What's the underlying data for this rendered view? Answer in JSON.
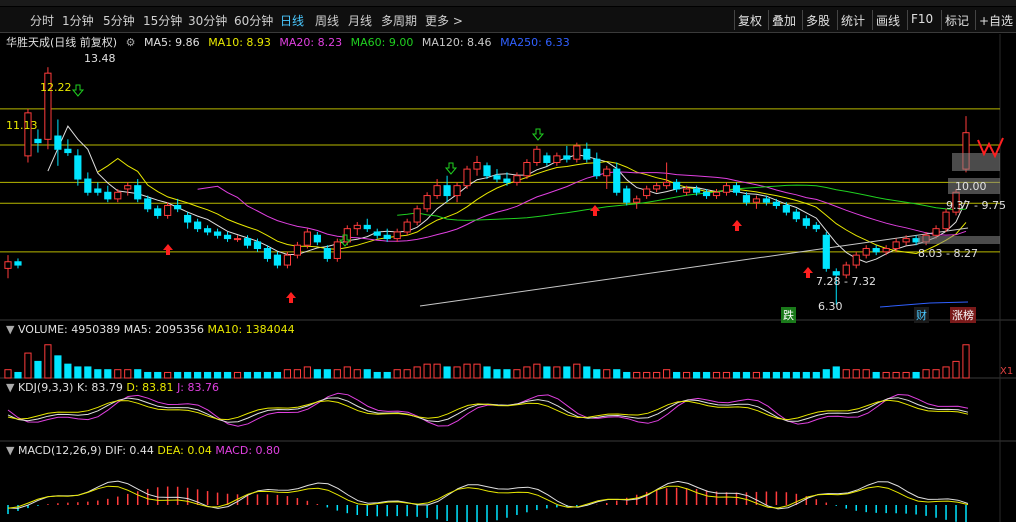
{
  "toolbar": {
    "timeframes": [
      "分时",
      "1分钟",
      "5分钟",
      "15分钟",
      "30分钟",
      "60分钟",
      "日线",
      "周线",
      "月线",
      "多周期",
      "更多 >"
    ],
    "active": "日线",
    "buttons": [
      "复权",
      "叠加",
      "多股",
      "统计",
      "画线",
      "F10",
      "标记",
      "+自选"
    ]
  },
  "main": {
    "stock_label": "华胜天成(日线 前复权)",
    "ma_labels": [
      {
        "text": "MA5: 9.86",
        "color": "#e0e0e0"
      },
      {
        "text": "MA10: 8.93",
        "color": "#e8e800"
      },
      {
        "text": "MA20: 8.23",
        "color": "#e040e0"
      },
      {
        "text": "MA60: 9.00",
        "color": "#20d020"
      },
      {
        "text": "MA120: 8.46",
        "color": "#c8c8c8"
      },
      {
        "text": "MA250: 6.33",
        "color": "#3060ff"
      }
    ],
    "price_labels": {
      "high": "13.48",
      "p1222": "12.22",
      "p1113": "11.13",
      "p1000": "10.00",
      "p937": "9.37 - 9.75",
      "p803": "8.03 - 8.27",
      "p728": "7.28 - 7.32",
      "low": "6.30"
    },
    "tags": {
      "die": "跌",
      "cai": "财",
      "zhangbang": "涨榜"
    }
  },
  "volume": {
    "label": "VOLUME: 4950389",
    "ma5": "MA5: 2095356",
    "ma10": "MA10: 1384044",
    "axis": "X1"
  },
  "kdj": {
    "label": "KDJ(9,3,3)",
    "k": "K: 83.79",
    "d": "D: 83.81",
    "j": "J: 83.76"
  },
  "macd": {
    "label": "MACD(12,26,9)",
    "dif": "DIF: 0.44",
    "dea": "DEA: 0.04",
    "macd": "MACD: 0.80"
  },
  "colors": {
    "up": "#ff3c3c",
    "down": "#00e5ff",
    "ma5": "#e0e0e0",
    "ma10": "#e8e800",
    "ma20": "#e040e0",
    "ma60": "#20d020",
    "ma120": "#c8c8c8",
    "ma250": "#3060ff"
  },
  "chart_data": {
    "type": "candlestick",
    "title": "华胜天成(日线 前复权)",
    "ylim": [
      5.9,
      14.0
    ],
    "candles": [
      {
        "o": 7.4,
        "h": 7.8,
        "l": 7.1,
        "c": 7.6
      },
      {
        "o": 7.6,
        "h": 7.7,
        "l": 7.4,
        "c": 7.5
      },
      {
        "o": 10.8,
        "h": 12.22,
        "l": 10.6,
        "c": 12.1
      },
      {
        "o": 11.3,
        "h": 11.6,
        "l": 10.9,
        "c": 11.2
      },
      {
        "o": 11.3,
        "h": 13.48,
        "l": 11.0,
        "c": 13.3
      },
      {
        "o": 11.4,
        "h": 11.9,
        "l": 10.5,
        "c": 11.0
      },
      {
        "o": 11.0,
        "h": 11.3,
        "l": 10.8,
        "c": 10.9
      },
      {
        "o": 10.8,
        "h": 11.0,
        "l": 9.9,
        "c": 10.1
      },
      {
        "o": 10.1,
        "h": 10.3,
        "l": 9.6,
        "c": 9.7
      },
      {
        "o": 9.8,
        "h": 10.0,
        "l": 9.6,
        "c": 9.7
      },
      {
        "o": 9.7,
        "h": 9.9,
        "l": 9.4,
        "c": 9.5
      },
      {
        "o": 9.5,
        "h": 9.8,
        "l": 9.4,
        "c": 9.7
      },
      {
        "o": 9.8,
        "h": 10.0,
        "l": 9.6,
        "c": 9.9
      },
      {
        "o": 9.9,
        "h": 10.1,
        "l": 9.4,
        "c": 9.5
      },
      {
        "o": 9.5,
        "h": 9.6,
        "l": 9.1,
        "c": 9.2
      },
      {
        "o": 9.2,
        "h": 9.3,
        "l": 8.9,
        "c": 9.0
      },
      {
        "o": 9.0,
        "h": 9.4,
        "l": 8.9,
        "c": 9.3
      },
      {
        "o": 9.3,
        "h": 9.5,
        "l": 9.1,
        "c": 9.2
      },
      {
        "o": 9.0,
        "h": 9.1,
        "l": 8.6,
        "c": 8.8
      },
      {
        "o": 8.8,
        "h": 8.9,
        "l": 8.5,
        "c": 8.6
      },
      {
        "o": 8.6,
        "h": 8.7,
        "l": 8.4,
        "c": 8.5
      },
      {
        "o": 8.5,
        "h": 8.6,
        "l": 8.3,
        "c": 8.4
      },
      {
        "o": 8.4,
        "h": 8.5,
        "l": 8.2,
        "c": 8.3
      },
      {
        "o": 8.3,
        "h": 8.4,
        "l": 8.2,
        "c": 8.3
      },
      {
        "o": 8.3,
        "h": 8.4,
        "l": 8.0,
        "c": 8.1
      },
      {
        "o": 8.2,
        "h": 8.3,
        "l": 7.9,
        "c": 8.0
      },
      {
        "o": 8.0,
        "h": 8.1,
        "l": 7.6,
        "c": 7.7
      },
      {
        "o": 7.8,
        "h": 7.9,
        "l": 7.4,
        "c": 7.5
      },
      {
        "o": 7.5,
        "h": 7.9,
        "l": 7.4,
        "c": 7.8
      },
      {
        "o": 7.8,
        "h": 8.2,
        "l": 7.7,
        "c": 8.1
      },
      {
        "o": 8.1,
        "h": 8.6,
        "l": 8.0,
        "c": 8.5
      },
      {
        "o": 8.4,
        "h": 8.5,
        "l": 8.1,
        "c": 8.2
      },
      {
        "o": 8.0,
        "h": 8.1,
        "l": 7.6,
        "c": 7.7
      },
      {
        "o": 7.7,
        "h": 8.3,
        "l": 7.6,
        "c": 8.2
      },
      {
        "o": 8.2,
        "h": 8.7,
        "l": 8.1,
        "c": 8.6
      },
      {
        "o": 8.6,
        "h": 8.8,
        "l": 8.4,
        "c": 8.7
      },
      {
        "o": 8.7,
        "h": 8.9,
        "l": 8.5,
        "c": 8.6
      },
      {
        "o": 8.5,
        "h": 8.6,
        "l": 8.3,
        "c": 8.4
      },
      {
        "o": 8.4,
        "h": 8.6,
        "l": 8.2,
        "c": 8.3
      },
      {
        "o": 8.3,
        "h": 8.6,
        "l": 8.2,
        "c": 8.5
      },
      {
        "o": 8.5,
        "h": 8.9,
        "l": 8.4,
        "c": 8.8
      },
      {
        "o": 8.8,
        "h": 9.3,
        "l": 8.7,
        "c": 9.2
      },
      {
        "o": 9.2,
        "h": 9.7,
        "l": 9.1,
        "c": 9.6
      },
      {
        "o": 9.6,
        "h": 10.1,
        "l": 9.5,
        "c": 9.9
      },
      {
        "o": 9.9,
        "h": 10.2,
        "l": 9.4,
        "c": 9.6
      },
      {
        "o": 9.6,
        "h": 10.0,
        "l": 9.4,
        "c": 9.9
      },
      {
        "o": 9.9,
        "h": 10.5,
        "l": 9.8,
        "c": 10.4
      },
      {
        "o": 10.4,
        "h": 10.8,
        "l": 10.2,
        "c": 10.6
      },
      {
        "o": 10.5,
        "h": 10.6,
        "l": 10.1,
        "c": 10.2
      },
      {
        "o": 10.2,
        "h": 10.4,
        "l": 10.0,
        "c": 10.1
      },
      {
        "o": 10.1,
        "h": 10.3,
        "l": 9.9,
        "c": 10.0
      },
      {
        "o": 10.0,
        "h": 10.3,
        "l": 9.9,
        "c": 10.2
      },
      {
        "o": 10.2,
        "h": 10.7,
        "l": 10.1,
        "c": 10.6
      },
      {
        "o": 10.6,
        "h": 11.1,
        "l": 10.5,
        "c": 11.0
      },
      {
        "o": 10.8,
        "h": 10.9,
        "l": 10.5,
        "c": 10.6
      },
      {
        "o": 10.6,
        "h": 10.9,
        "l": 10.5,
        "c": 10.8
      },
      {
        "o": 10.8,
        "h": 11.1,
        "l": 10.6,
        "c": 10.7
      },
      {
        "o": 10.7,
        "h": 11.2,
        "l": 10.6,
        "c": 11.1
      },
      {
        "o": 11.0,
        "h": 11.2,
        "l": 10.6,
        "c": 10.7
      },
      {
        "o": 10.7,
        "h": 10.9,
        "l": 10.1,
        "c": 10.2
      },
      {
        "o": 10.2,
        "h": 10.5,
        "l": 9.8,
        "c": 10.4
      },
      {
        "o": 10.4,
        "h": 10.6,
        "l": 9.6,
        "c": 9.7
      },
      {
        "o": 9.8,
        "h": 9.9,
        "l": 9.3,
        "c": 9.4
      },
      {
        "o": 9.4,
        "h": 9.6,
        "l": 9.2,
        "c": 9.5
      },
      {
        "o": 9.6,
        "h": 9.9,
        "l": 9.5,
        "c": 9.8
      },
      {
        "o": 9.8,
        "h": 10.0,
        "l": 9.7,
        "c": 9.9
      },
      {
        "o": 9.9,
        "h": 10.6,
        "l": 9.8,
        "c": 10.0
      },
      {
        "o": 10.0,
        "h": 10.1,
        "l": 9.7,
        "c": 9.8
      },
      {
        "o": 9.7,
        "h": 9.9,
        "l": 9.6,
        "c": 9.8
      },
      {
        "o": 9.8,
        "h": 9.9,
        "l": 9.6,
        "c": 9.7
      },
      {
        "o": 9.7,
        "h": 9.8,
        "l": 9.5,
        "c": 9.6
      },
      {
        "o": 9.6,
        "h": 9.8,
        "l": 9.5,
        "c": 9.7
      },
      {
        "o": 9.7,
        "h": 10.0,
        "l": 9.6,
        "c": 9.9
      },
      {
        "o": 9.9,
        "h": 10.0,
        "l": 9.6,
        "c": 9.7
      },
      {
        "o": 9.6,
        "h": 9.7,
        "l": 9.3,
        "c": 9.4
      },
      {
        "o": 9.4,
        "h": 9.6,
        "l": 9.2,
        "c": 9.5
      },
      {
        "o": 9.5,
        "h": 9.6,
        "l": 9.3,
        "c": 9.4
      },
      {
        "o": 9.4,
        "h": 9.5,
        "l": 9.2,
        "c": 9.3
      },
      {
        "o": 9.3,
        "h": 9.4,
        "l": 9.0,
        "c": 9.1
      },
      {
        "o": 9.1,
        "h": 9.2,
        "l": 8.8,
        "c": 8.9
      },
      {
        "o": 8.9,
        "h": 9.0,
        "l": 8.6,
        "c": 8.7
      },
      {
        "o": 8.7,
        "h": 8.8,
        "l": 8.5,
        "c": 8.6
      },
      {
        "o": 8.4,
        "h": 8.5,
        "l": 7.3,
        "c": 7.4
      },
      {
        "o": 7.3,
        "h": 7.4,
        "l": 6.3,
        "c": 7.2
      },
      {
        "o": 7.2,
        "h": 7.6,
        "l": 7.1,
        "c": 7.5
      },
      {
        "o": 7.5,
        "h": 7.9,
        "l": 7.4,
        "c": 7.8
      },
      {
        "o": 7.8,
        "h": 8.1,
        "l": 7.7,
        "c": 8.0
      },
      {
        "o": 8.0,
        "h": 8.1,
        "l": 7.8,
        "c": 7.9
      },
      {
        "o": 7.9,
        "h": 8.1,
        "l": 7.8,
        "c": 8.0
      },
      {
        "o": 8.0,
        "h": 8.3,
        "l": 7.9,
        "c": 8.2
      },
      {
        "o": 8.2,
        "h": 8.4,
        "l": 8.1,
        "c": 8.3
      },
      {
        "o": 8.3,
        "h": 8.4,
        "l": 8.1,
        "c": 8.2
      },
      {
        "o": 8.2,
        "h": 8.5,
        "l": 8.1,
        "c": 8.4
      },
      {
        "o": 8.4,
        "h": 8.7,
        "l": 8.3,
        "c": 8.6
      },
      {
        "o": 8.6,
        "h": 9.2,
        "l": 8.5,
        "c": 9.1
      },
      {
        "o": 9.1,
        "h": 9.8,
        "l": 9.0,
        "c": 9.7
      },
      {
        "o": 10.4,
        "h": 12.0,
        "l": 10.3,
        "c": 11.5
      }
    ],
    "volume": [
      3,
      2,
      9,
      6,
      12,
      8,
      5,
      4,
      4,
      3,
      3,
      3,
      3,
      3,
      2,
      2,
      2,
      2,
      2,
      2,
      2,
      2,
      2,
      2,
      2,
      2,
      2,
      2,
      3,
      3,
      4,
      3,
      3,
      3,
      4,
      3,
      3,
      2,
      2,
      3,
      3,
      4,
      5,
      5,
      4,
      4,
      5,
      5,
      4,
      3,
      3,
      3,
      4,
      5,
      4,
      4,
      4,
      5,
      4,
      3,
      3,
      3,
      2,
      2,
      2,
      2,
      3,
      2,
      2,
      2,
      2,
      2,
      2,
      2,
      2,
      2,
      2,
      2,
      2,
      2,
      2,
      2,
      3,
      4,
      3,
      3,
      3,
      2,
      2,
      2,
      2,
      2,
      3,
      3,
      4,
      6,
      12
    ],
    "vol_ylim": [
      0,
      13
    ]
  }
}
